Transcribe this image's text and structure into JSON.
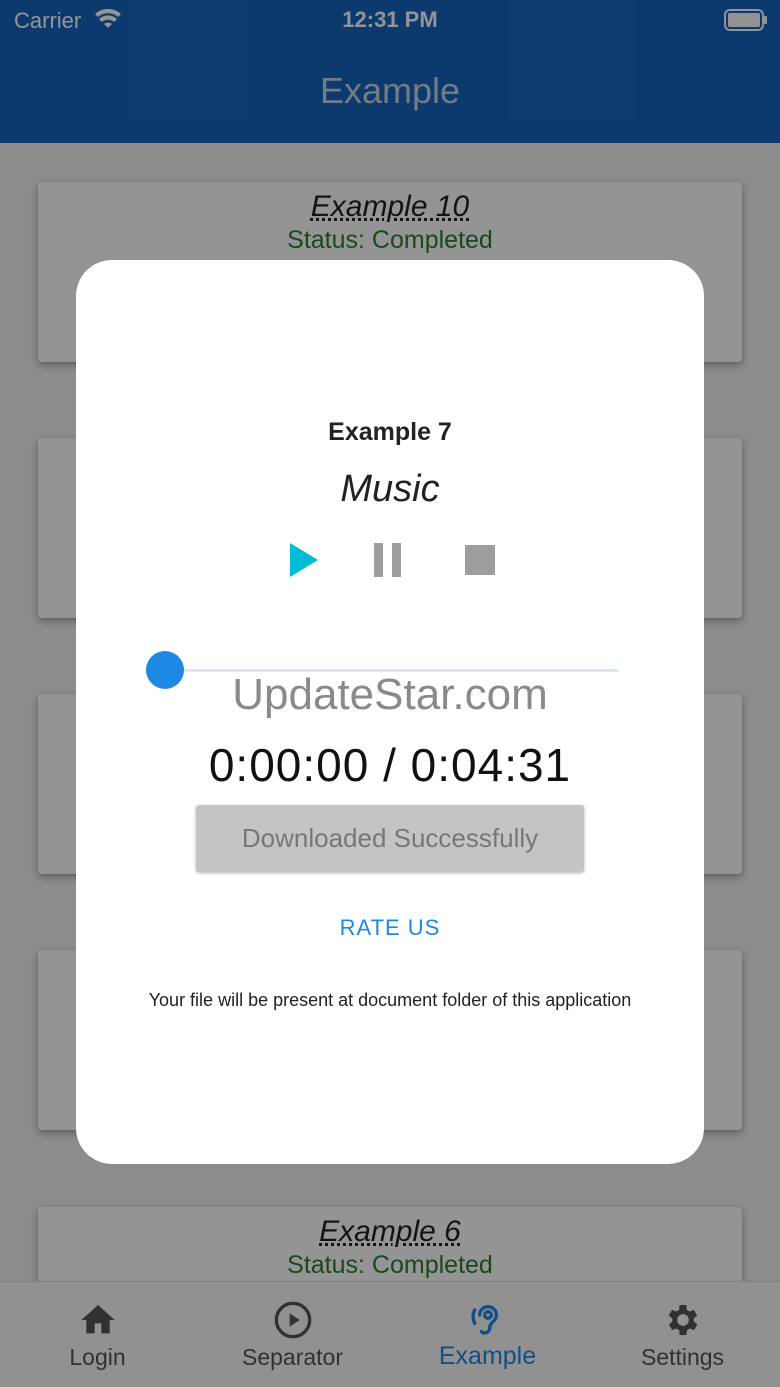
{
  "status_bar": {
    "carrier": "Carrier",
    "time": "12:31 PM"
  },
  "header": {
    "title": "Example"
  },
  "list": {
    "cards": [
      {
        "title": "Example 10",
        "status": "Status: Completed"
      },
      {
        "title": "",
        "status": ""
      },
      {
        "title": "",
        "status": ""
      },
      {
        "title": "",
        "status": ""
      },
      {
        "title": "Example 6",
        "status": "Status: Completed"
      }
    ]
  },
  "dialog": {
    "title": "Example 7",
    "subtitle": "Music",
    "controls": [
      "play-icon",
      "pause-icon",
      "stop-icon"
    ],
    "slider_progress": 0.0,
    "watermark": "UpdateStar.com",
    "timer": "0:00:00 / 0:04:31",
    "download_label": "Downloaded Successfully",
    "rate_label": "RATE US",
    "note": "Your file will be present at document folder of this application"
  },
  "tabbar": {
    "tabs": [
      {
        "label": "Login",
        "icon": "home-icon"
      },
      {
        "label": "Separator",
        "icon": "play-circle-icon"
      },
      {
        "label": "Example",
        "icon": "hearing-icon",
        "active": true
      },
      {
        "label": "Settings",
        "icon": "gear-icon"
      }
    ]
  },
  "colors": {
    "primary": "#1565c0",
    "accent": "#1e88e5",
    "play": "#00bcd4",
    "status_ok": "#2e7d32"
  }
}
